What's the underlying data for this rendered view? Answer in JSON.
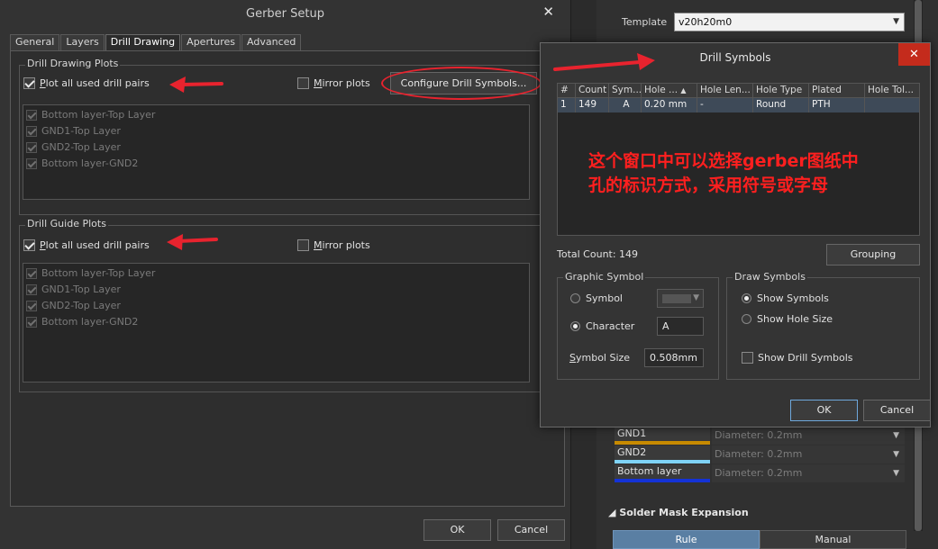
{
  "gerber": {
    "title": "Gerber Setup",
    "close": "✕",
    "tabs": [
      "General",
      "Layers",
      "Drill Drawing",
      "Apertures",
      "Advanced"
    ],
    "drawing": {
      "group": "Drill Drawing Plots",
      "plot_all_first": "P",
      "plot_all_rest": "lot all used drill pairs",
      "mirror_first": "M",
      "mirror_rest": "irror plots",
      "configure": "Configure Drill Symbols...",
      "pairs": [
        "Bottom layer-Top Layer",
        "GND1-Top Layer",
        "GND2-Top Layer",
        "Bottom layer-GND2"
      ]
    },
    "guide": {
      "group": "Drill Guide Plots",
      "plot_all_first": "P",
      "plot_all_rest": "lot all used drill pairs",
      "mirror_first": "M",
      "mirror_rest": "irror plots",
      "pairs": [
        "Bottom layer-Top Layer",
        "GND1-Top Layer",
        "GND2-Top Layer",
        "Bottom layer-GND2"
      ]
    },
    "ok": "OK",
    "cancel": "Cancel"
  },
  "panel": {
    "template_label": "Template",
    "template_value": "v20h20m0",
    "layers": [
      {
        "name": "GND1",
        "diameter": "Diameter: 0.2mm",
        "color": "#c78a00"
      },
      {
        "name": "GND2",
        "diameter": "Diameter: 0.2mm",
        "color": "#7fd3f7"
      },
      {
        "name": "Bottom layer",
        "diameter": "Diameter: 0.2mm",
        "color": "#1432d6"
      }
    ],
    "section": "Solder Mask Expansion",
    "seg_rule": "Rule",
    "seg_manual": "Manual"
  },
  "drill": {
    "title": "Drill Symbols",
    "close": "✕",
    "columns": [
      "#",
      "Count",
      "Sym...",
      "Hole ...",
      "Hole Len...",
      "Hole Type",
      "Plated",
      "Hole Tol..."
    ],
    "rows": [
      [
        "1",
        "149",
        "A",
        "0.20 mm",
        "-",
        "Round",
        "PTH",
        ""
      ]
    ],
    "annotation_line1": "这个窗口中可以选择gerber图纸中",
    "annotation_line2": "孔的标识方式，采用符号或字母",
    "total_count": "Total Count: 149",
    "grouping": "Grouping",
    "graphic": {
      "group": "Graphic Symbol",
      "symbol": "Symbol",
      "character": "Character",
      "character_value": "A",
      "size_first": "S",
      "size_rest": "ymbol Size",
      "size_value": "0.508mm"
    },
    "draw": {
      "group": "Draw Symbols",
      "show_symbols": "Show Symbols",
      "show_hole_size": "Show Hole Size",
      "show_drill_symbols": "Show Drill Symbols"
    },
    "ok": "OK",
    "cancel": "Cancel"
  },
  "colors": {
    "annotation_red": "#e8232e",
    "selection_row": "#3e4a58",
    "close_red": "#c42b1c"
  }
}
